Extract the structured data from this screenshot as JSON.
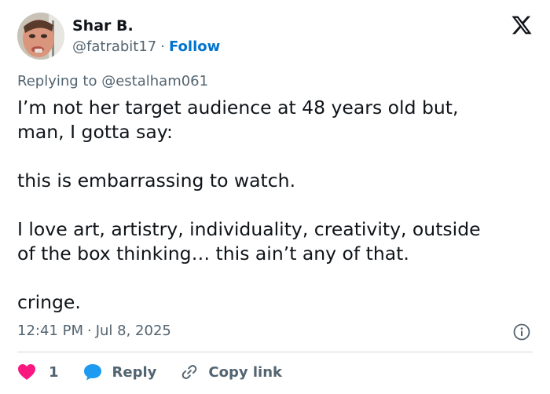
{
  "author": {
    "name": "Shar B.",
    "handle": "@fatrabit17",
    "separator": "·",
    "follow_label": "Follow"
  },
  "icons": {
    "brand": "x-logo-icon",
    "info": "info-icon",
    "like": "heart-icon",
    "reply": "speech-bubble-icon",
    "copy": "link-icon"
  },
  "replying": {
    "prefix": "Replying to",
    "handle": "@estalham061"
  },
  "tweet": {
    "lines": [
      "I’m not her target audience at 48 years old but,",
      "man, I gotta say:",
      "this is embarrassing to watch.",
      "I love art, artistry, individuality, creativity, outside",
      "of the box thinking… this ain’t any of that.",
      "cringe."
    ]
  },
  "meta": {
    "time": "12:41 PM",
    "separator": "·",
    "date": "Jul 8, 2025"
  },
  "actions": {
    "like_count": "1",
    "reply_label": "Reply",
    "copy_label": "Copy link"
  },
  "colors": {
    "text": "#0f1419",
    "secondary": "#536471",
    "link": "#0074cc",
    "like": "#f91880",
    "reply": "#1d9bf0",
    "divider": "#cfd9de"
  }
}
